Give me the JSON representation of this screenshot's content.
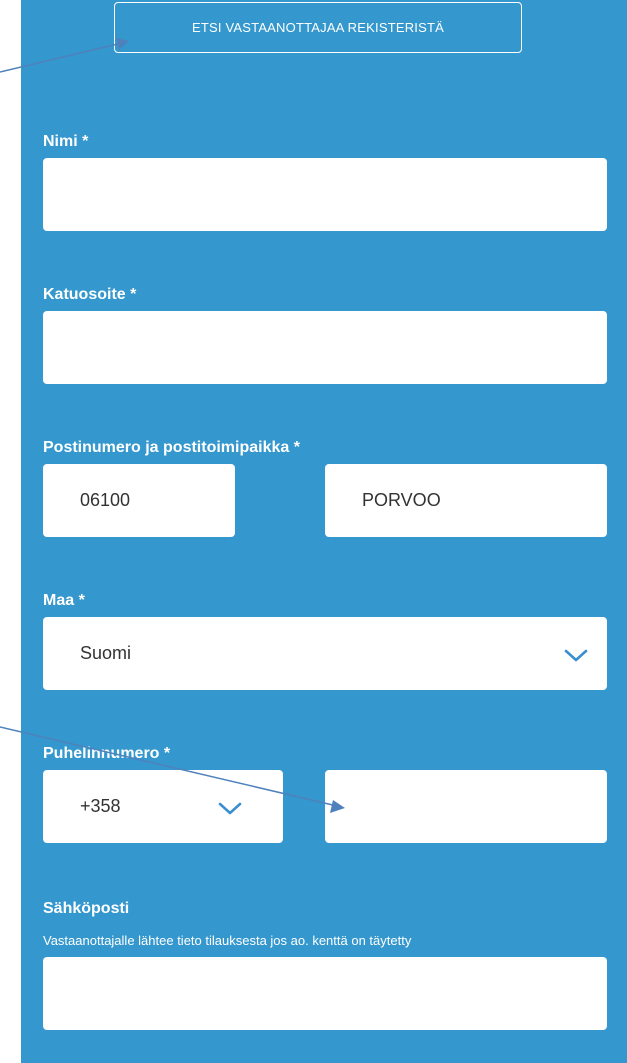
{
  "search_button": {
    "label": "ETSI VASTAANOTTAJAA REKISTERISTÄ"
  },
  "name": {
    "label": "Nimi *",
    "value": ""
  },
  "street": {
    "label": "Katuosoite *",
    "value": ""
  },
  "postal": {
    "label": "Postinumero ja postitoimipaikka *",
    "code_value": "06100",
    "city_value": "PORVOO"
  },
  "country": {
    "label": "Maa *",
    "selected": "Suomi"
  },
  "phone": {
    "label": "Puhelinnumero *",
    "prefix_selected": "+358",
    "number_value": ""
  },
  "email": {
    "label": "Sähköposti",
    "hint": "Vastaanottajalle lähtee tieto tilauksesta jos ao. kenttä on täytetty",
    "value": ""
  },
  "colors": {
    "panel": "#3497cd",
    "field": "#ffffff",
    "chevron": "#3a8fd0",
    "annotation_arrow": "#4f81bd"
  },
  "icons": {
    "country_dropdown": "chevron-down-icon",
    "prefix_dropdown": "chevron-down-icon"
  }
}
